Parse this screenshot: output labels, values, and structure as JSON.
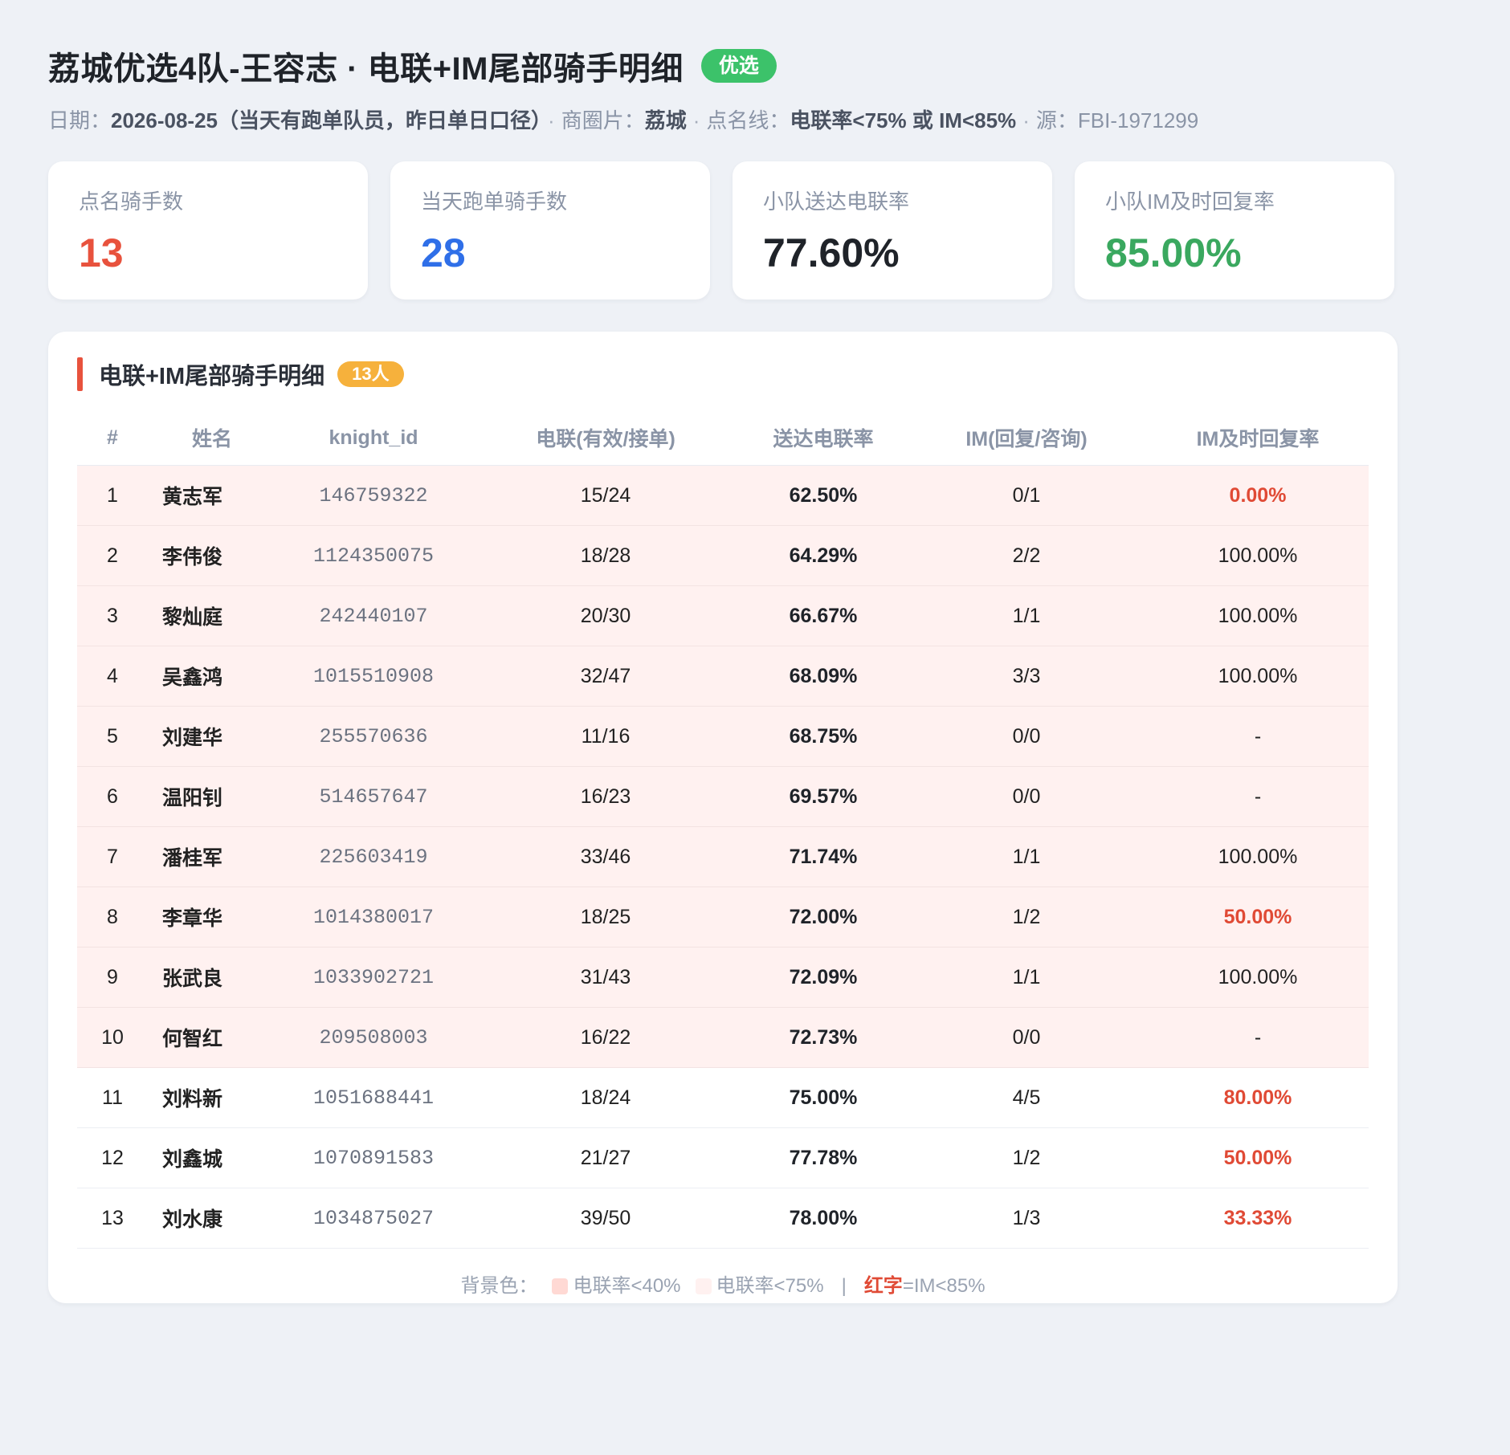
{
  "header": {
    "title": "荔城优选4队-王容志 · 电联+IM尾部骑手明细",
    "tag": "优选",
    "date_label": "日期：",
    "date_value": "2026-08-25（当天有跑单队员，昨日单日口径）",
    "area_label": "商圈片：",
    "area_value": "荔城",
    "threshold_label": "点名线：",
    "threshold_value": "电联率<75% 或 IM<85%",
    "source_label": "源：",
    "source_value": "FBI-1971299"
  },
  "cards": [
    {
      "label": "点名骑手数",
      "value": "13",
      "color": "#e8523d"
    },
    {
      "label": "当天跑单骑手数",
      "value": "28",
      "color": "#2f6fe8"
    },
    {
      "label": "小队送达电联率",
      "value": "77.60%",
      "color": "#1f2329"
    },
    {
      "label": "小队IM及时回复率",
      "value": "85.00%",
      "color": "#3aa85f"
    }
  ],
  "section": {
    "title": "电联+IM尾部骑手明细",
    "count": "13人"
  },
  "table": {
    "columns": [
      "#",
      "姓名",
      "knight_id",
      "电联(有效/接单)",
      "送达电联率",
      "IM(回复/咨询)",
      "IM及时回复率"
    ],
    "rows": [
      {
        "no": "1",
        "name": "黄志军",
        "kid": "146759322",
        "call": "15/24",
        "rate": "62.50%",
        "im": "0/1",
        "im_rate": "0.00%",
        "im_red": true,
        "hl": true
      },
      {
        "no": "2",
        "name": "李伟俊",
        "kid": "1124350075",
        "call": "18/28",
        "rate": "64.29%",
        "im": "2/2",
        "im_rate": "100.00%",
        "im_red": false,
        "hl": true
      },
      {
        "no": "3",
        "name": "黎灿庭",
        "kid": "242440107",
        "call": "20/30",
        "rate": "66.67%",
        "im": "1/1",
        "im_rate": "100.00%",
        "im_red": false,
        "hl": true
      },
      {
        "no": "4",
        "name": "吴鑫鸿",
        "kid": "1015510908",
        "call": "32/47",
        "rate": "68.09%",
        "im": "3/3",
        "im_rate": "100.00%",
        "im_red": false,
        "hl": true
      },
      {
        "no": "5",
        "name": "刘建华",
        "kid": "255570636",
        "call": "11/16",
        "rate": "68.75%",
        "im": "0/0",
        "im_rate": "-",
        "im_red": false,
        "hl": true
      },
      {
        "no": "6",
        "name": "温阳钊",
        "kid": "514657647",
        "call": "16/23",
        "rate": "69.57%",
        "im": "0/0",
        "im_rate": "-",
        "im_red": false,
        "hl": true
      },
      {
        "no": "7",
        "name": "潘桂军",
        "kid": "225603419",
        "call": "33/46",
        "rate": "71.74%",
        "im": "1/1",
        "im_rate": "100.00%",
        "im_red": false,
        "hl": true
      },
      {
        "no": "8",
        "name": "李章华",
        "kid": "1014380017",
        "call": "18/25",
        "rate": "72.00%",
        "im": "1/2",
        "im_rate": "50.00%",
        "im_red": true,
        "hl": true
      },
      {
        "no": "9",
        "name": "张武良",
        "kid": "1033902721",
        "call": "31/43",
        "rate": "72.09%",
        "im": "1/1",
        "im_rate": "100.00%",
        "im_red": false,
        "hl": true
      },
      {
        "no": "10",
        "name": "何智红",
        "kid": "209508003",
        "call": "16/22",
        "rate": "72.73%",
        "im": "0/0",
        "im_rate": "-",
        "im_red": false,
        "hl": true
      },
      {
        "no": "11",
        "name": "刘料新",
        "kid": "1051688441",
        "call": "18/24",
        "rate": "75.00%",
        "im": "4/5",
        "im_rate": "80.00%",
        "im_red": true,
        "hl": false
      },
      {
        "no": "12",
        "name": "刘鑫城",
        "kid": "1070891583",
        "call": "21/27",
        "rate": "77.78%",
        "im": "1/2",
        "im_rate": "50.00%",
        "im_red": true,
        "hl": false
      },
      {
        "no": "13",
        "name": "刘水康",
        "kid": "1034875027",
        "call": "39/50",
        "rate": "78.00%",
        "im": "1/3",
        "im_rate": "33.33%",
        "im_red": true,
        "hl": false
      }
    ]
  },
  "legend": {
    "prefix": "背景色：",
    "item1": "电联率<40%",
    "item1_color": "#ffd9d4",
    "item2": "电联率<75%",
    "item2_color": "#fff1f0",
    "pipe": "|",
    "red_word": "红字",
    "red_rest": "=IM<85%"
  }
}
